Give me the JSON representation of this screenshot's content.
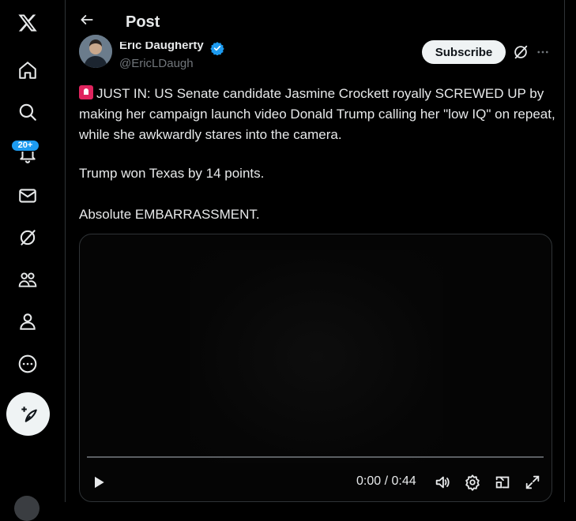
{
  "sidebar": {
    "notifications_badge": "20+",
    "items": [
      {
        "name": "home"
      },
      {
        "name": "explore"
      },
      {
        "name": "notifications"
      },
      {
        "name": "messages"
      },
      {
        "name": "grok"
      },
      {
        "name": "communities"
      },
      {
        "name": "profile"
      },
      {
        "name": "more"
      }
    ]
  },
  "header": {
    "title": "Post"
  },
  "post": {
    "author_name": "Eric Daugherty",
    "author_handle": "@EricLDaugh",
    "subscribe_label": "Subscribe",
    "text_line1": "JUST IN: US Senate candidate Jasmine Crockett royally SCREWED UP by making her campaign launch video Donald Trump calling her \"low IQ\" on repeat, while she awkwardly stares into the camera.",
    "text_line2": "Trump won Texas by 14 points.",
    "text_line3": "Absolute EMBARRASSMENT."
  },
  "video": {
    "time": "0:00 / 0:44",
    "progress": 0.0
  },
  "colors": {
    "accent": "#1d9bf0",
    "background": "#000000",
    "text": "#e7e9ea",
    "secondary_text": "#71767b"
  }
}
